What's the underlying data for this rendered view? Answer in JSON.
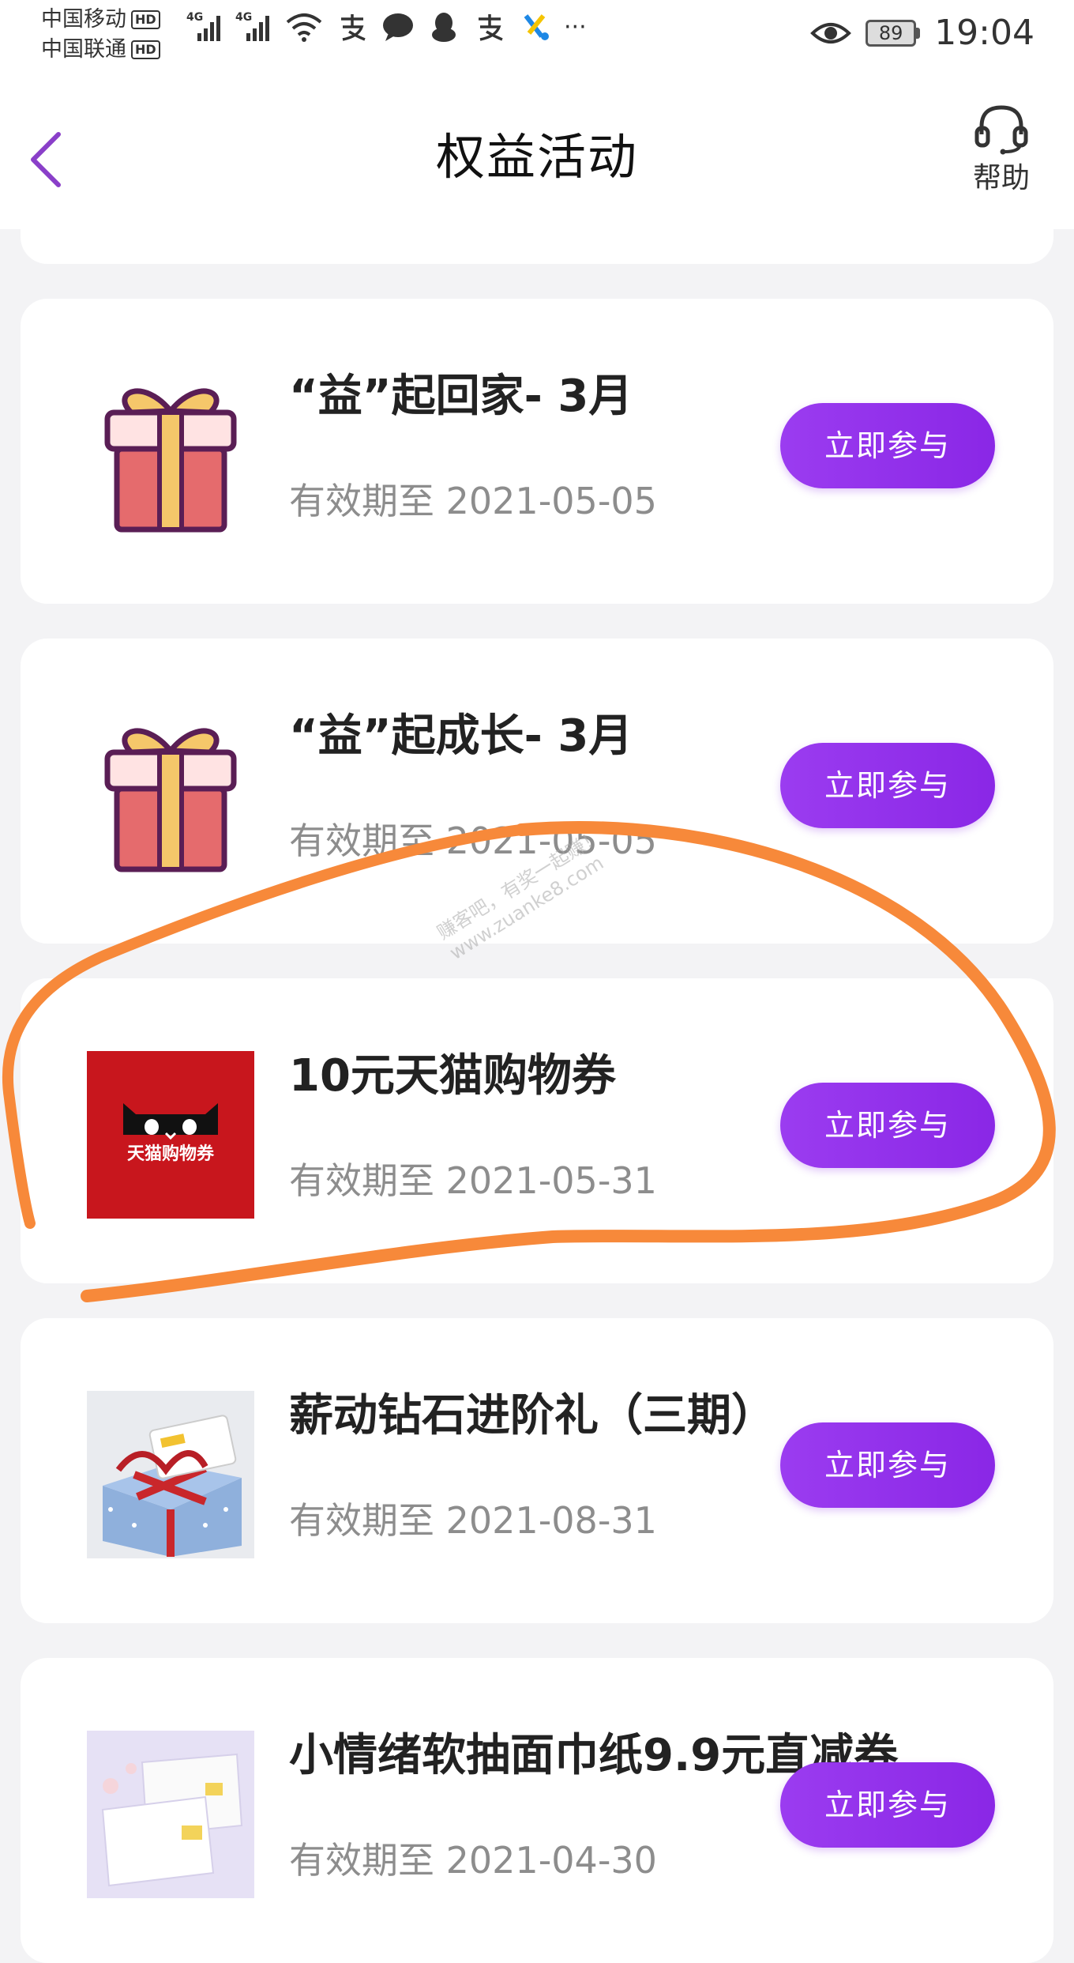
{
  "status_bar": {
    "carrier1": "中国移动",
    "carrier2": "中国联通",
    "hd_badge": "HD",
    "network1": "4G",
    "network2": "4G",
    "more": "···",
    "battery": "89",
    "time": "19:04"
  },
  "header": {
    "title": "权益活动",
    "help_label": "帮助"
  },
  "activities": [
    {
      "title": "“益”起回家- 3月",
      "date": "有效期至 2021-05-05",
      "button": "立即参与",
      "thumb": "gift-box"
    },
    {
      "title": "“益”起成长- 3月",
      "date": "有效期至 2021-05-05",
      "button": "立即参与",
      "thumb": "gift-box"
    },
    {
      "title": "10元天猫购物券",
      "date": "有效期至 2021-05-31",
      "button": "立即参与",
      "thumb": "tmall-coupon",
      "thumb_text": "天猫购物券"
    },
    {
      "title": "薪动钻石进阶礼（三期）",
      "date": "有效期至 2021-08-31",
      "button": "立即参与",
      "thumb": "gift-photo"
    },
    {
      "title": "小情绪软抽面巾纸9.9元直减券",
      "date": "有效期至 2021-04-30",
      "button": "立即参与",
      "thumb": "tissue-photo"
    }
  ],
  "watermark": {
    "line1": "赚客吧，有奖一起赚！",
    "line2": "www.zuanke8.com"
  },
  "colors": {
    "accent_purple": "#8f2fea",
    "highlight_orange": "#f7893a",
    "tmall_red": "#c8161d",
    "gift_red": "#e56b6d",
    "gift_gold": "#f5c76a",
    "gift_outline": "#5a1e55"
  }
}
